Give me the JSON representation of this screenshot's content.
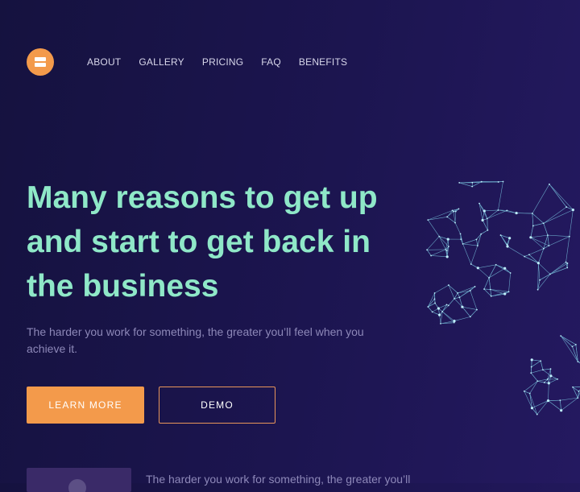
{
  "nav": {
    "items": [
      "ABOUT",
      "GALLERY",
      "PRICING",
      "FAQ",
      "BENEFITS"
    ]
  },
  "hero": {
    "headline_lines": [
      "Many reasons to get up",
      "and start to get back in",
      "the business"
    ],
    "subtitle": "The harder you work for something, the greater you’ll feel when you achieve it.",
    "primary_button": "LEARN MORE",
    "secondary_button": "DEMO"
  },
  "feature": {
    "teaser_text": "The harder you work for something, the greater you’ll"
  },
  "colors": {
    "background": "#1a1448",
    "accent_orange": "#f39a4b",
    "headline_mint": "#8fe8c8",
    "subtitle_lavender": "#8d88b8",
    "mesh_cyan": "#7fd0e8"
  },
  "icons": {
    "logo": "logo-icon"
  }
}
